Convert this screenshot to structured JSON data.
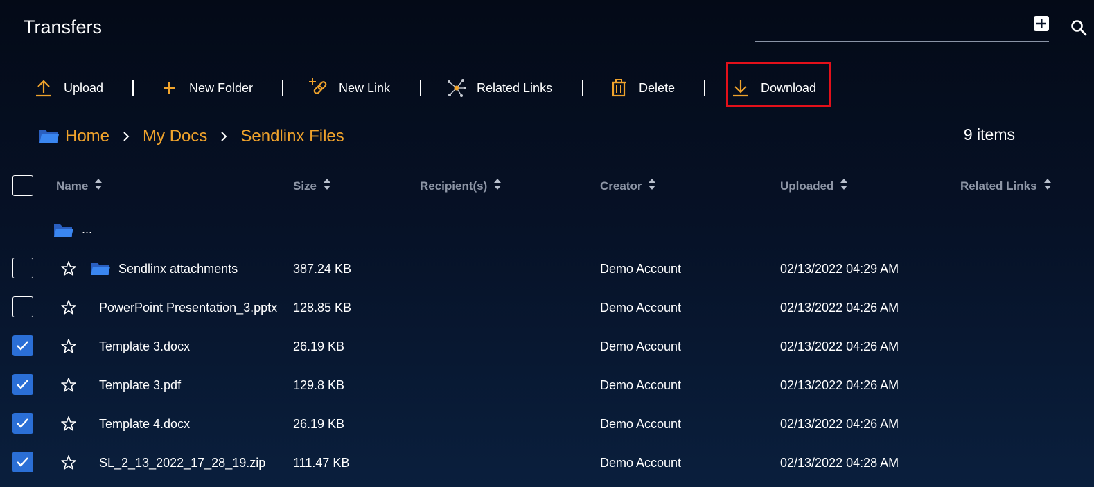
{
  "app": {
    "title": "Transfers"
  },
  "header_icons": [
    "add-icon",
    "search-icon"
  ],
  "toolbar": {
    "upload": "Upload",
    "new_folder": "New Folder",
    "new_link": "New Link",
    "related_links": "Related Links",
    "delete": "Delete",
    "download": "Download"
  },
  "breadcrumb": [
    "Home",
    "My Docs",
    "Sendlinx Files"
  ],
  "item_count": "9 items",
  "columns": {
    "name": "Name",
    "size": "Size",
    "recipients": "Recipient(s)",
    "creator": "Creator",
    "uploaded": "Uploaded",
    "related_links": "Related Links"
  },
  "parent_row": {
    "label": "..."
  },
  "rows": [
    {
      "name": "Sendlinx attachments",
      "size": "387.24 KB",
      "creator": "Demo Account",
      "uploaded": "02/13/2022 04:29 AM",
      "checked": false,
      "folder": true
    },
    {
      "name": "PowerPoint Presentation_3.pptx",
      "size": "128.85 KB",
      "creator": "Demo Account",
      "uploaded": "02/13/2022 04:26 AM",
      "checked": false,
      "folder": false
    },
    {
      "name": "Template 3.docx",
      "size": "26.19 KB",
      "creator": "Demo Account",
      "uploaded": "02/13/2022 04:26 AM",
      "checked": true,
      "folder": false
    },
    {
      "name": "Template 3.pdf",
      "size": "129.8 KB",
      "creator": "Demo Account",
      "uploaded": "02/13/2022 04:26 AM",
      "checked": true,
      "folder": false
    },
    {
      "name": "Template 4.docx",
      "size": "26.19 KB",
      "creator": "Demo Account",
      "uploaded": "02/13/2022 04:26 AM",
      "checked": true,
      "folder": false
    },
    {
      "name": "SL_2_13_2022_17_28_19.zip",
      "size": "111.47 KB",
      "creator": "Demo Account",
      "uploaded": "02/13/2022 04:28 AM",
      "checked": true,
      "folder": false
    }
  ],
  "colors": {
    "accent": "#f0a32c",
    "checkbox_checked": "#2b6fd6",
    "folder": "#3a86f0",
    "highlight": "#e3101a",
    "header_text": "#8e96a6"
  }
}
